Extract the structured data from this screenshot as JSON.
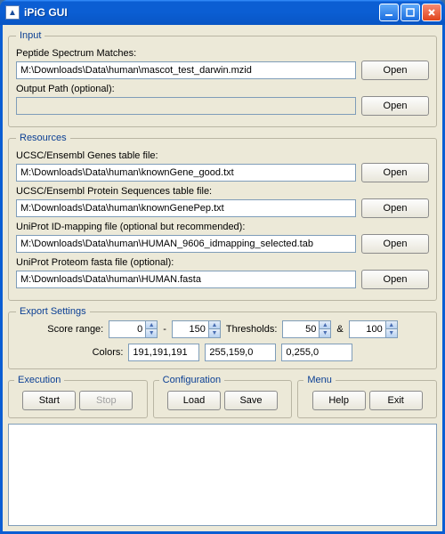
{
  "window": {
    "title": "iPiG GUI",
    "app_icon_char": "▲"
  },
  "input": {
    "legend": "Input",
    "psm_label": "Peptide Spectrum Matches:",
    "psm_value": "M:\\Downloads\\Data\\human\\mascot_test_darwin.mzid",
    "output_label": "Output Path (optional):",
    "output_value": "",
    "open": "Open"
  },
  "resources": {
    "legend": "Resources",
    "genes_label": "UCSC/Ensembl Genes table file:",
    "genes_value": "M:\\Downloads\\Data\\human\\knownGene_good.txt",
    "protein_label": "UCSC/Ensembl Protein Sequences table file:",
    "protein_value": "M:\\Downloads\\Data\\human\\knownGenePep.txt",
    "uniprot_id_label": "UniProt ID-mapping file  (optional but recommended):",
    "uniprot_id_value": "M:\\Downloads\\Data\\human\\HUMAN_9606_idmapping_selected.tab",
    "uniprot_fasta_label": "UniProt Proteom fasta file  (optional):",
    "uniprot_fasta_value": "M:\\Downloads\\Data\\human\\HUMAN.fasta",
    "open": "Open"
  },
  "export": {
    "legend": "Export Settings",
    "score_label": "Score range:",
    "score_min": "0",
    "dash": "-",
    "score_max": "150",
    "thresholds_label": "Thresholds:",
    "th1": "50",
    "amp": "&",
    "th2": "100",
    "colors_label": "Colors:",
    "color1": "191,191,191",
    "color2": "255,159,0",
    "color3": "0,255,0"
  },
  "execution": {
    "legend": "Execution",
    "start": "Start",
    "stop": "Stop"
  },
  "configuration": {
    "legend": "Configuration",
    "load": "Load",
    "save": "Save"
  },
  "menu": {
    "legend": "Menu",
    "help": "Help",
    "exit": "Exit"
  }
}
